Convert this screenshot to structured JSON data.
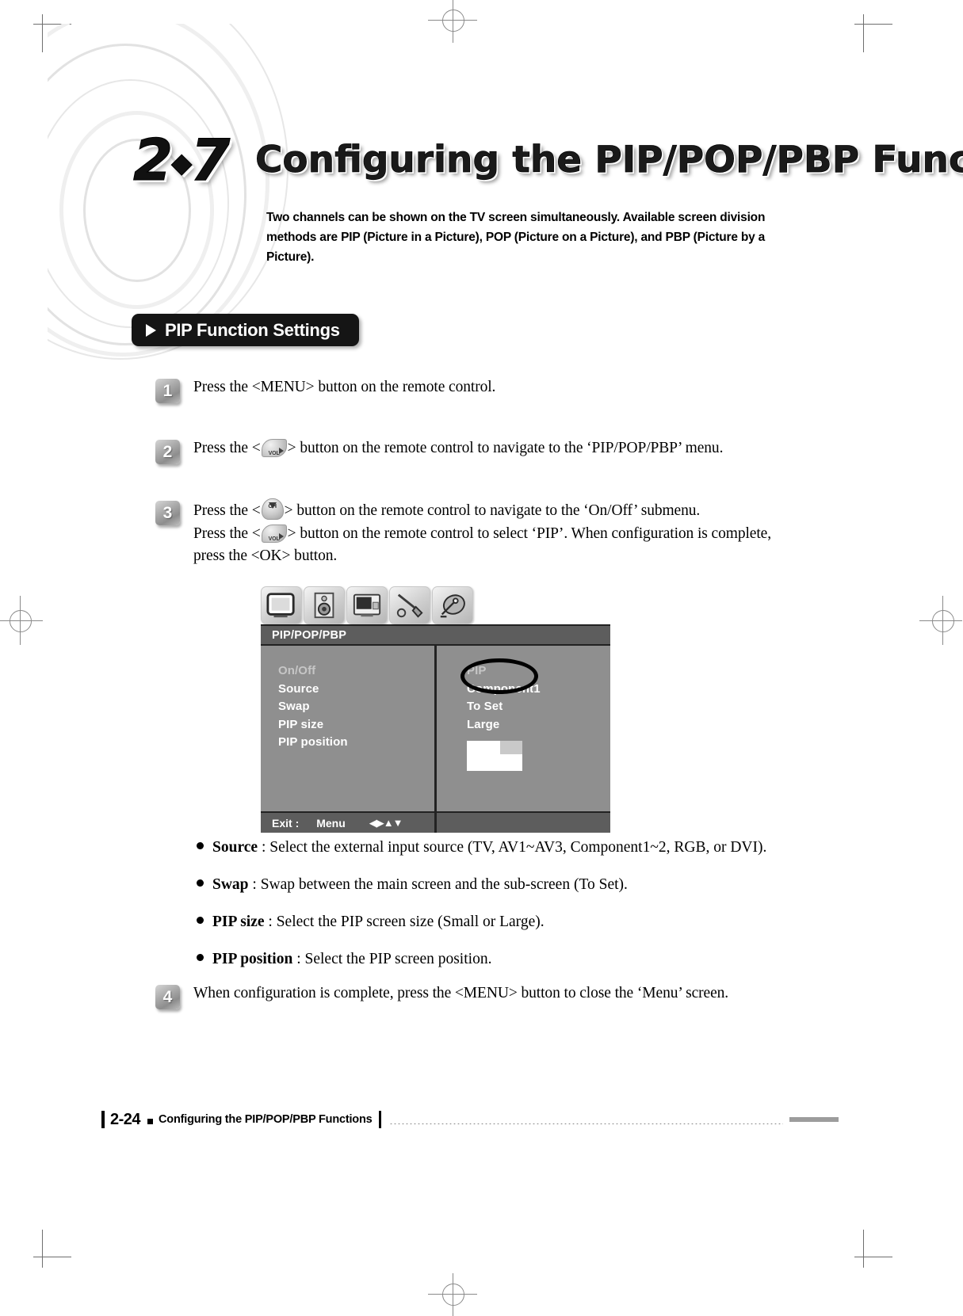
{
  "chapter": {
    "number": "2",
    "number_suffix": "7",
    "title": "Configuring the PIP/POP/PBP Functions",
    "intro": "Two channels can be shown on the TV screen simultaneously. Available screen division methods are PIP (Picture in a Picture), POP (Picture on a Picture), and PBP (Picture by a Picture)."
  },
  "section": {
    "heading": "PIP Function Settings"
  },
  "steps": [
    {
      "number": "1",
      "parts": [
        {
          "type": "text",
          "value": "Press the <MENU> button on the remote control."
        }
      ]
    },
    {
      "number": "2",
      "parts": [
        {
          "type": "text",
          "value": "Press the <"
        },
        {
          "type": "key",
          "value": "VOL",
          "icon": "vol-key-icon"
        },
        {
          "type": "text",
          "value": "> button on the remote control to navigate to the ‘PIP/POP/PBP’ menu."
        }
      ]
    },
    {
      "number": "3",
      "parts": [
        {
          "type": "text",
          "value": "Press the <"
        },
        {
          "type": "key",
          "value": "CH",
          "icon": "ch-key-icon"
        },
        {
          "type": "text",
          "value": "> button on the remote control to navigate to the ‘On/Off’ submenu."
        },
        {
          "type": "break"
        },
        {
          "type": "text",
          "value": "Press the <"
        },
        {
          "type": "key",
          "value": "VOL",
          "icon": "vol-key-icon"
        },
        {
          "type": "text",
          "value": "> button on the remote control to select ‘PIP’. When configuration is complete, press the <OK> button."
        }
      ]
    },
    {
      "number": "4",
      "parts": [
        {
          "type": "text",
          "value": "When configuration is complete, press the <MENU> button to close the ‘Menu’ screen."
        }
      ]
    }
  ],
  "osd": {
    "tabs": [
      {
        "name": "picture-tab",
        "icon": "tv-icon"
      },
      {
        "name": "sound-tab",
        "icon": "speaker-icon"
      },
      {
        "name": "screen-tab",
        "icon": "monitor-icon"
      },
      {
        "name": "setup-tab",
        "icon": "tool-icon"
      },
      {
        "name": "channel-tab",
        "icon": "satellite-dish-icon"
      }
    ],
    "title": "PIP/POP/PBP",
    "left_items": [
      {
        "label": "On/Off",
        "selected": true
      },
      {
        "label": "Source",
        "selected": false
      },
      {
        "label": "Swap",
        "selected": false
      },
      {
        "label": "PIP size",
        "selected": false
      },
      {
        "label": "PIP position",
        "selected": false
      }
    ],
    "right_items": [
      {
        "label": "PIP",
        "selected": true,
        "circled": true
      },
      {
        "label": "Component1",
        "selected": false,
        "circled": false
      },
      {
        "label": "To Set",
        "selected": false,
        "circled": false
      },
      {
        "label": "Large",
        "selected": false,
        "circled": false
      }
    ],
    "footer": {
      "exit_label": "Exit :",
      "menu_label": "Menu",
      "arrows": "◀▶▲▼"
    }
  },
  "bullets": [
    {
      "term": "Source",
      "desc": " : Select the external input source (TV, AV1~AV3, Component1~2, RGB, or DVI)."
    },
    {
      "term": "Swap",
      "desc": " : Swap between the main screen and the sub-screen (To Set)."
    },
    {
      "term": "PIP size",
      "desc": " : Select the PIP screen size (Small or Large)."
    },
    {
      "term": "PIP position",
      "desc": " : Select the PIP screen position."
    }
  ],
  "footer": {
    "page_number": "2-24",
    "text": "Configuring the PIP/POP/PBP Functions"
  },
  "colors": {
    "osd_background": "#8f8f8f",
    "osd_bar": "#5d5d5d",
    "pill": "#151515",
    "selected_text": "#c6c6c6"
  }
}
